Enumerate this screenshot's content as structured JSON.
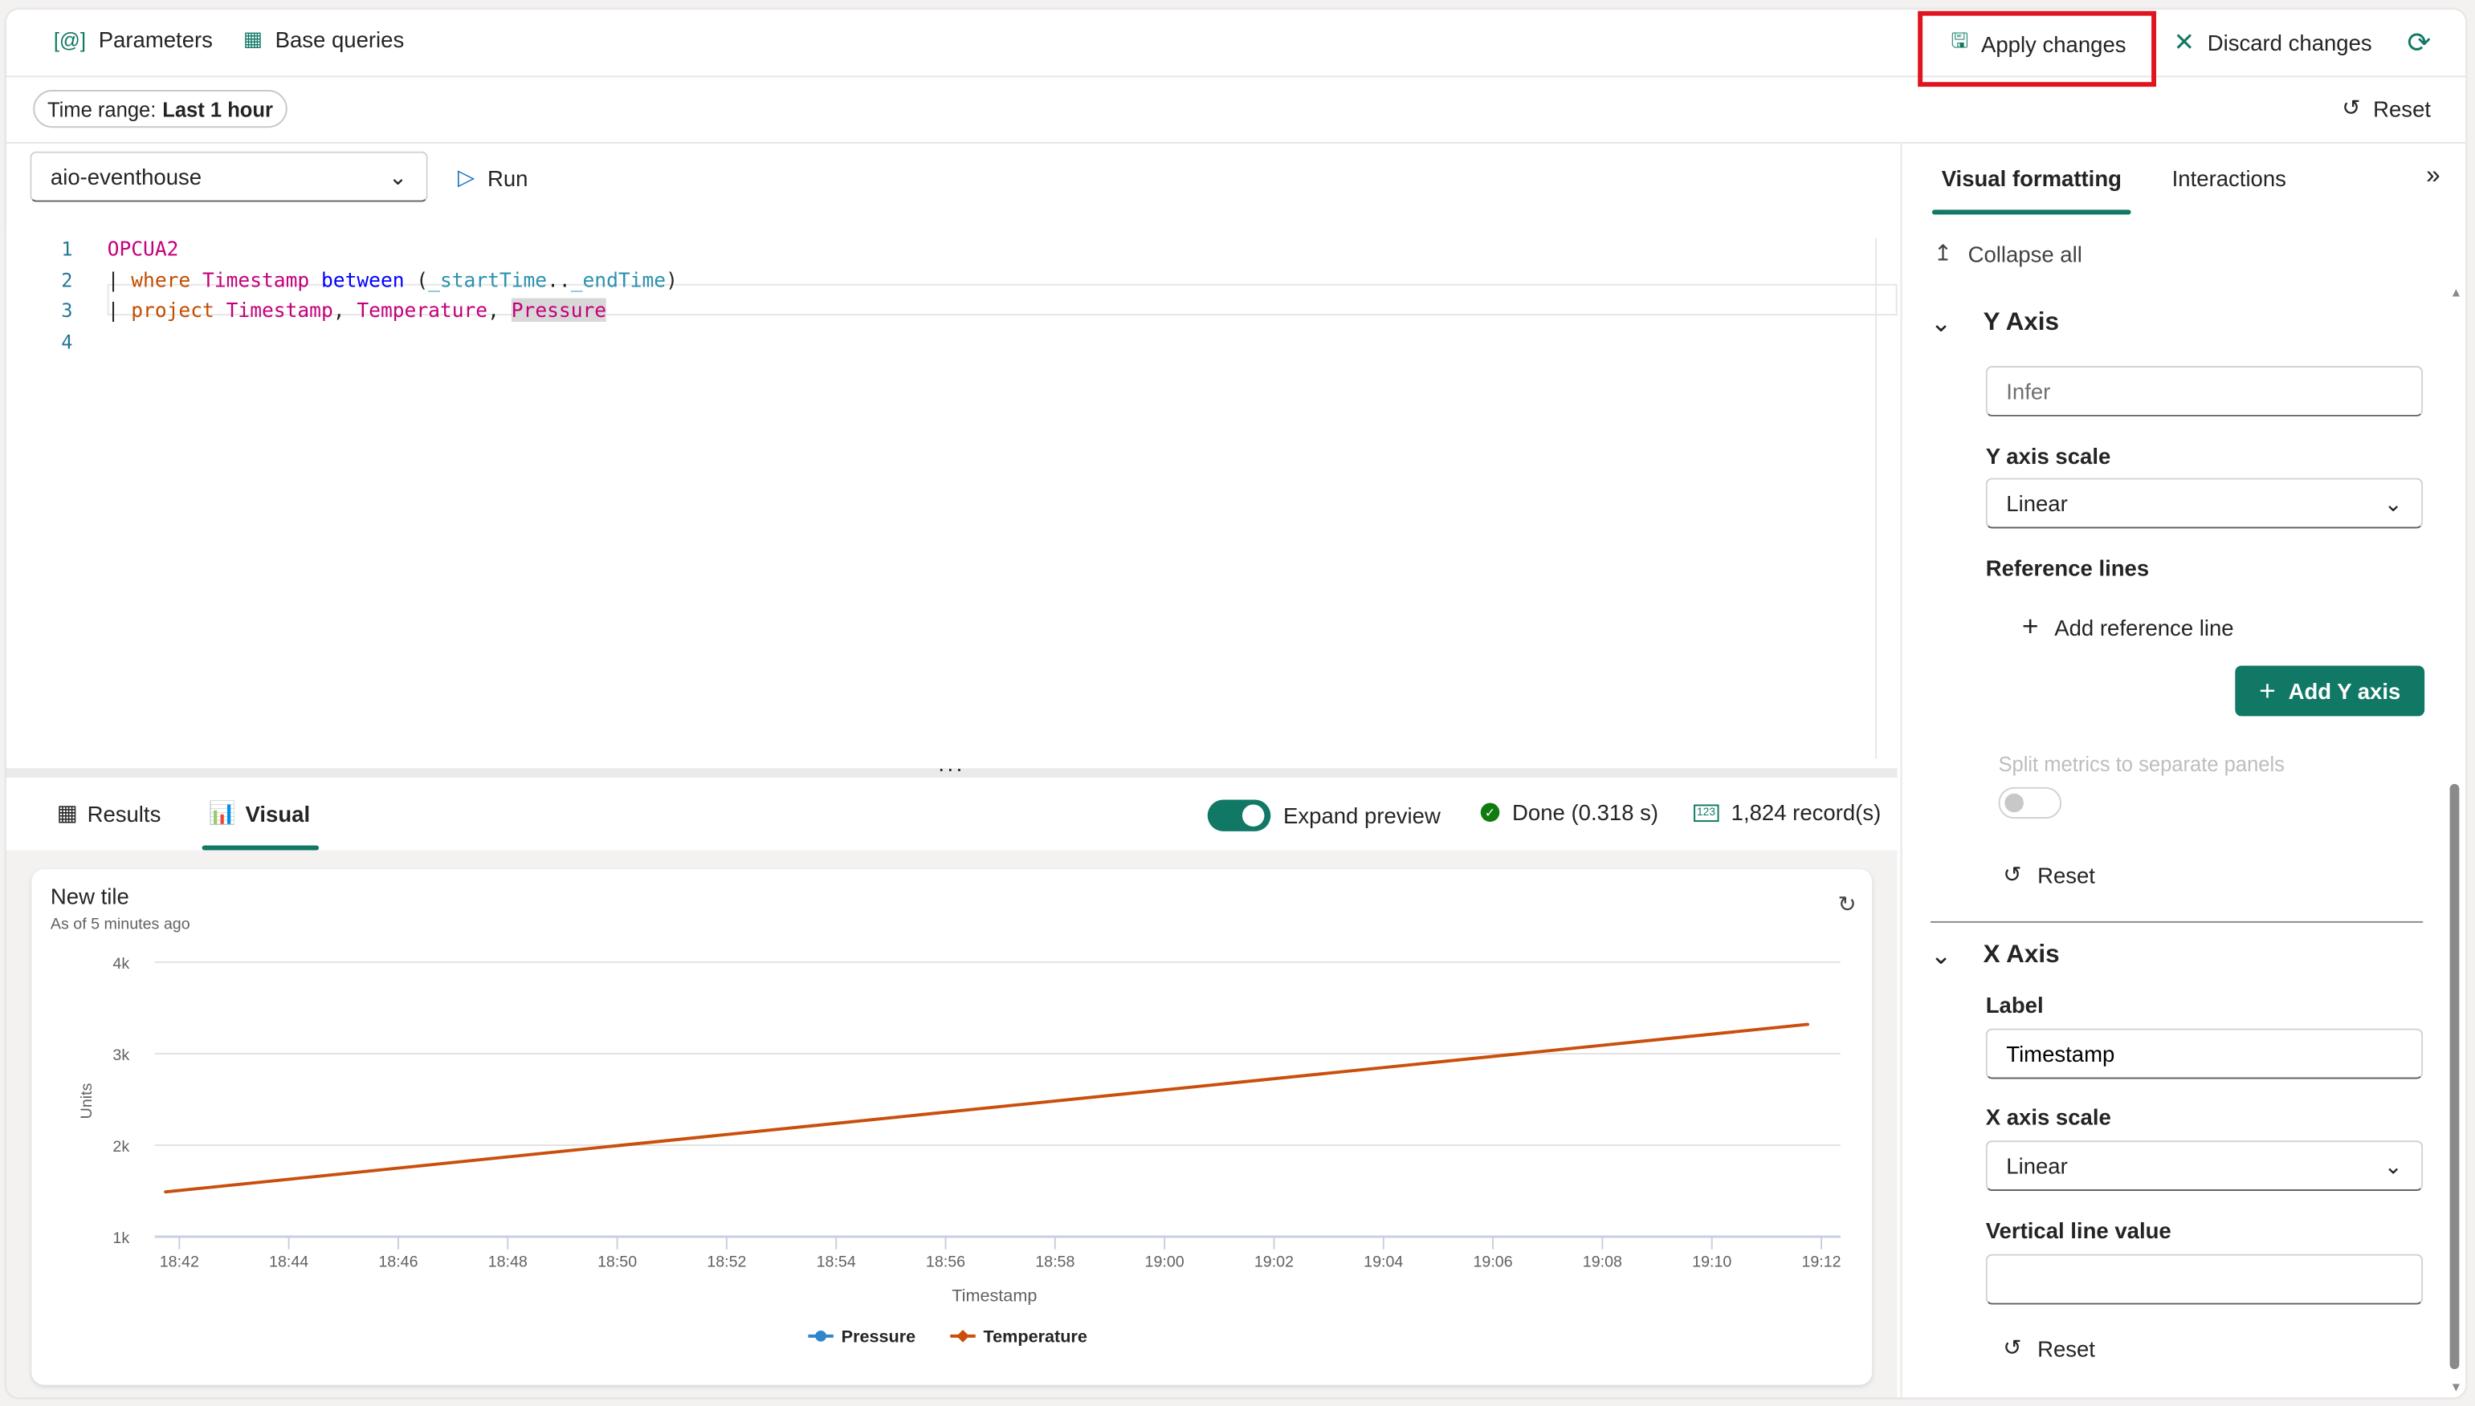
{
  "toolbar": {
    "parameters_label": "Parameters",
    "base_queries_label": "Base queries",
    "apply_changes_label": "Apply changes",
    "discard_changes_label": "Discard changes",
    "highlight_color": "#e0141e"
  },
  "filters": {
    "time_range_prefix": "Time range:",
    "time_range_value": "Last 1 hour",
    "reset_label": "Reset"
  },
  "query": {
    "database": "aio-eventhouse",
    "run_label": "Run",
    "line_numbers": [
      "1",
      "2",
      "3",
      "4"
    ],
    "lines": [
      [
        {
          "t": "OPCUA2",
          "c": "tb"
        }
      ],
      [
        {
          "t": "| ",
          "c": "op"
        },
        {
          "t": "where",
          "c": "kw"
        },
        {
          "t": " ",
          "c": "op"
        },
        {
          "t": "Timestamp",
          "c": "tb"
        },
        {
          "t": " ",
          "c": "op"
        },
        {
          "t": "between",
          "c": "fn"
        },
        {
          "t": " (",
          "c": "op"
        },
        {
          "t": "_startTime",
          "c": "pa"
        },
        {
          "t": "..",
          "c": "op"
        },
        {
          "t": "_endTime",
          "c": "pa"
        },
        {
          "t": ")",
          "c": "op"
        }
      ],
      [
        {
          "t": "| ",
          "c": "op"
        },
        {
          "t": "project",
          "c": "kw"
        },
        {
          "t": " ",
          "c": "op"
        },
        {
          "t": "Timestamp",
          "c": "tb"
        },
        {
          "t": ", ",
          "c": "op"
        },
        {
          "t": "Temperature",
          "c": "tb"
        },
        {
          "t": ", ",
          "c": "op"
        },
        {
          "t": "Pressure",
          "c": "tb sel"
        }
      ],
      []
    ]
  },
  "results": {
    "tabs": [
      {
        "label": "Results",
        "icon": "table-icon",
        "active": false
      },
      {
        "label": "Visual",
        "icon": "chart-icon",
        "active": true
      }
    ],
    "expand_preview_label": "Expand preview",
    "expand_preview_on": true,
    "status": "Done (0.318 s)",
    "records": "1,824 record(s)"
  },
  "tile": {
    "title": "New tile",
    "subtitle": "As of 5 minutes ago"
  },
  "chart_data": {
    "type": "line",
    "title": "New tile",
    "xlabel": "Timestamp",
    "ylabel": "Units",
    "x_ticks": [
      "18:42",
      "18:44",
      "18:46",
      "18:48",
      "18:50",
      "18:52",
      "18:54",
      "18:56",
      "18:58",
      "19:00",
      "19:02",
      "19:04",
      "19:06",
      "19:08",
      "19:10",
      "19:12"
    ],
    "y_ticks": [
      "1k",
      "2k",
      "3k",
      "4k"
    ],
    "ylim": [
      1000,
      4000
    ],
    "xlim_minutes": [
      -0.45,
      30.35
    ],
    "x_origin": "18:42",
    "grid": true,
    "legend_position": "bottom",
    "series": [
      {
        "name": "Pressure",
        "color": "#2e86cc",
        "marker": "circle",
        "points": []
      },
      {
        "name": "Temperature",
        "color": "#c94f0c",
        "marker": "diamond",
        "points": [
          {
            "t": "18:41:45",
            "m": -0.25,
            "v": 1490
          },
          {
            "t": "18:50",
            "m": 8,
            "v": 1995
          },
          {
            "t": "19:00",
            "m": 18,
            "v": 2605
          },
          {
            "t": "19:11:45",
            "m": 29.75,
            "v": 3320
          }
        ]
      }
    ]
  },
  "panel": {
    "tabs": [
      {
        "label": "Visual formatting",
        "active": true
      },
      {
        "label": "Interactions",
        "active": false
      }
    ],
    "collapse_all_label": "Collapse all",
    "y_axis": {
      "heading": "Y Axis",
      "label_placeholder": "Infer",
      "scale_label": "Y axis scale",
      "scale_value": "Linear",
      "reference_lines_label": "Reference lines",
      "add_reference_line_label": "Add reference line",
      "add_y_axis_label": "Add Y axis",
      "split_metrics_label": "Split metrics to separate panels",
      "split_metrics_on": false,
      "reset_label": "Reset"
    },
    "x_axis": {
      "heading": "X Axis",
      "label_label": "Label",
      "label_value": "Timestamp",
      "scale_label": "X axis scale",
      "scale_value": "Linear",
      "vertical_line_label": "Vertical line value",
      "vertical_line_value": "",
      "reset_label": "Reset"
    }
  }
}
